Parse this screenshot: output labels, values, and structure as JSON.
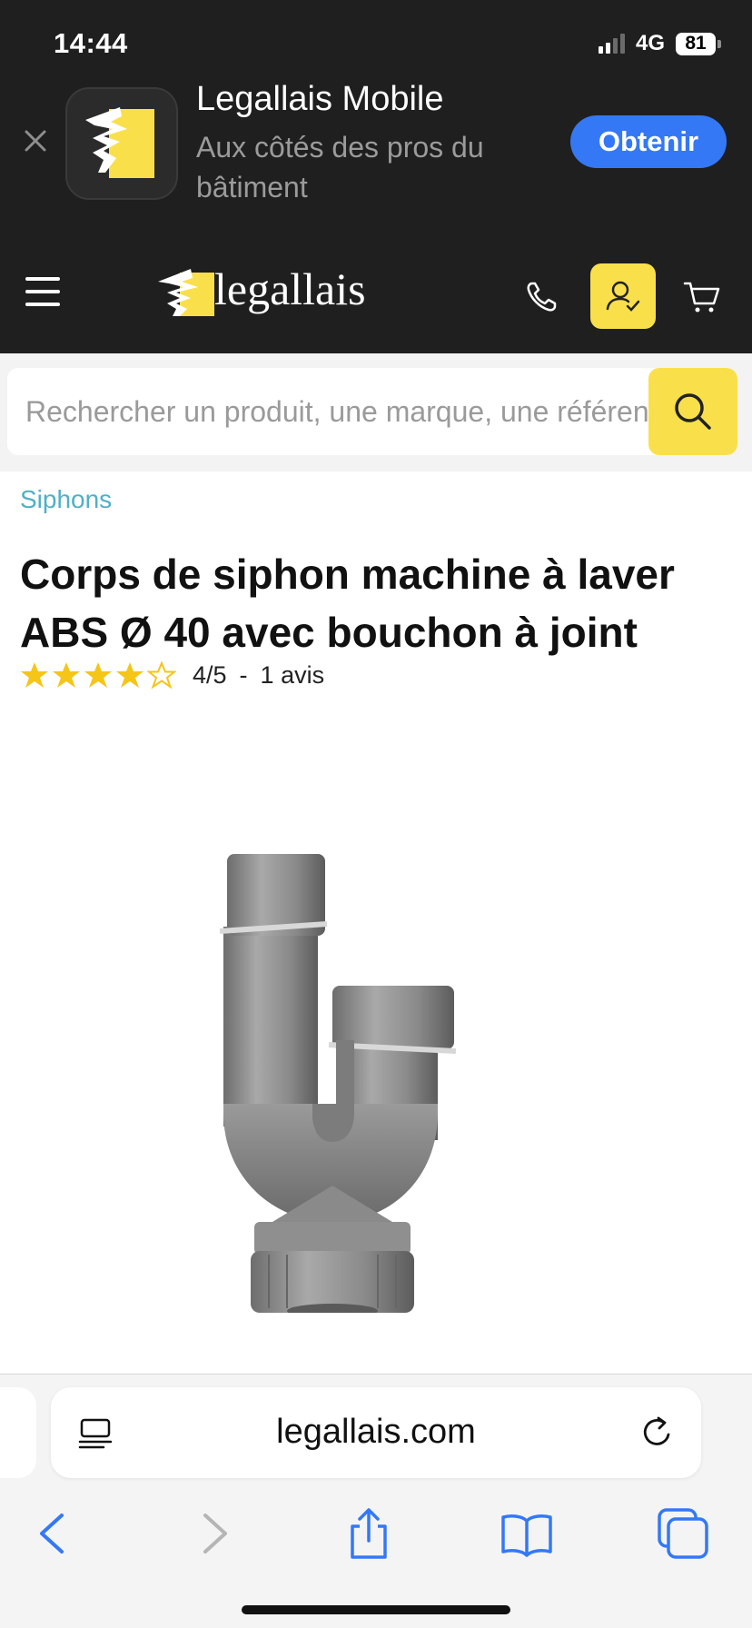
{
  "status_bar": {
    "time": "14:44",
    "network": "4G",
    "battery": "81"
  },
  "app_banner": {
    "app_name": "Legallais Mobile",
    "subtitle": "Aux côtés des pros du bâtiment",
    "get_label": "Obtenir"
  },
  "header": {
    "logo_text": "legallais",
    "accent_color": "#f9e04b"
  },
  "search": {
    "placeholder": "Rechercher un produit, une marque, une référence"
  },
  "breadcrumb": "Siphons",
  "product": {
    "title": "Corps de siphon machine à laver ABS Ø 40 avec bouchon à joint",
    "rating_value": 4,
    "rating_max": 5,
    "rating_text": "4/5",
    "separator": "-",
    "reviews": "1 avis"
  },
  "browser": {
    "url": "legallais.com"
  },
  "colors": {
    "brand_yellow": "#f9e04b",
    "link": "#4fb0c6",
    "ios_blue": "#3478f6",
    "header_bg": "#1f1f1f"
  }
}
